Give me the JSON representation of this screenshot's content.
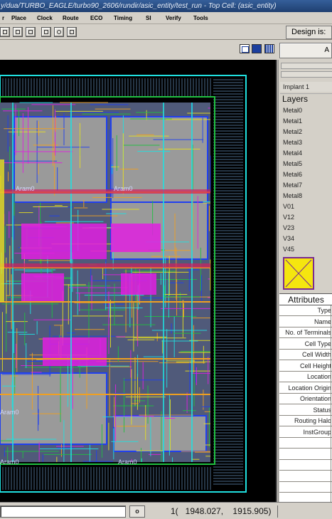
{
  "window": {
    "title": "y/dua/TURBO_EAGLE/turbo90_2606/rundir/asic_entity/test_run - Top Cell: (asic_entity)"
  },
  "menubar": {
    "items": [
      "r",
      "Place",
      "Clock",
      "Route",
      "ECO",
      "Timing",
      "SI",
      "Verify",
      "Tools"
    ]
  },
  "toolbar": {
    "design_label": "Design is:"
  },
  "view_controls": {
    "dropdown_value": "A"
  },
  "canvas": {
    "macro_labels": [
      "Aram0",
      "Aram0",
      "Aram0",
      "Aram0",
      "Aram0"
    ],
    "colors": {
      "background": "#000000",
      "macro": "#9a9a9a",
      "magenta": "#e020e0",
      "orange": "#f0a020",
      "cyan": "#20e0e0",
      "blue": "#2040f0",
      "green": "#20c040",
      "yellow": "#e8e020"
    }
  },
  "layers_panel": {
    "implant_label": "Implant 1",
    "header": "Layers",
    "items": [
      "Metal0",
      "Metal1",
      "Metal2",
      "Metal3",
      "Metal4",
      "Metal5",
      "Metal6",
      "Metal7",
      "Metal8",
      "V01",
      "V12",
      "V23",
      "V34",
      "V45"
    ]
  },
  "attributes": {
    "header": "Attributes",
    "rows": [
      "Type",
      "Name",
      "No. of Terminals",
      "Cell Type",
      "Cell Width",
      "Cell Height",
      "Location",
      "Location Origin",
      "Orientation",
      "Status",
      "Routing Halo",
      "InstGroup"
    ]
  },
  "statusbar": {
    "button_label": "o",
    "coords_text": "1(   1948.027,    1915.905)"
  }
}
